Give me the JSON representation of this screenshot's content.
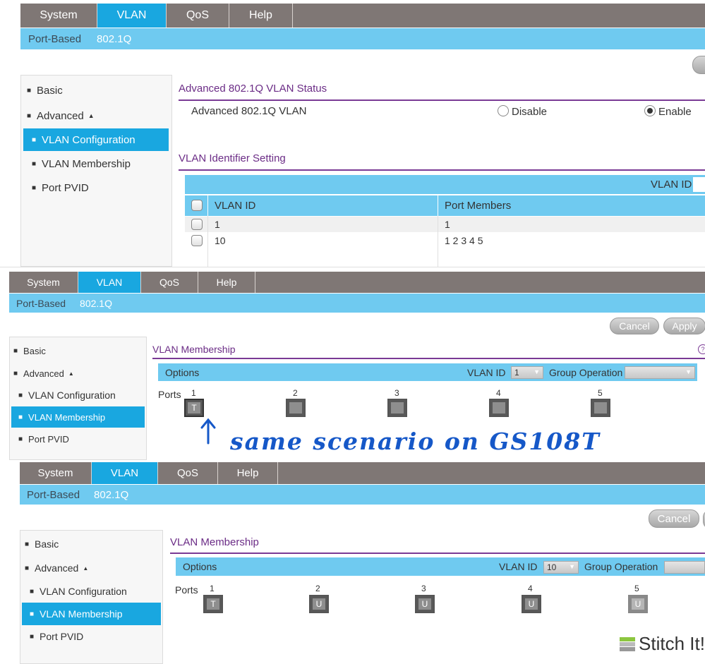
{
  "nav": [
    "System",
    "VLAN",
    "QoS",
    "Help"
  ],
  "subnav": [
    "Port-Based",
    "802.1Q"
  ],
  "sidebar": {
    "basic": "Basic",
    "advanced": "Advanced",
    "items": [
      "VLAN Configuration",
      "VLAN Membership",
      "Port PVID"
    ]
  },
  "panel1": {
    "status_title": "Advanced 802.1Q VLAN Status",
    "status_label": "Advanced 802.1Q VLAN",
    "disable": "Disable",
    "enable": "Enable",
    "selected": "Enable",
    "id_title": "VLAN Identifier Setting",
    "vlan_id_label": "VLAN ID",
    "columns": [
      "VLAN ID",
      "Port Members"
    ],
    "rows": [
      {
        "vlan_id": "1",
        "members": "1"
      },
      {
        "vlan_id": "10",
        "members": "1 2 3 4 5"
      }
    ]
  },
  "panel2": {
    "cancel": "Cancel",
    "apply": "Apply",
    "title": "VLAN Membership",
    "options": "Options",
    "vlan_id_label": "VLAN ID",
    "vlan_id_value": "1",
    "group_operation": "Group Operation",
    "ports_label": "Ports",
    "ports": [
      {
        "num": "1",
        "mark": "T"
      },
      {
        "num": "2",
        "mark": ""
      },
      {
        "num": "3",
        "mark": ""
      },
      {
        "num": "4",
        "mark": ""
      },
      {
        "num": "5",
        "mark": ""
      }
    ],
    "annotation": "same scenario on GS108T"
  },
  "panel3": {
    "cancel": "Cancel",
    "title": "VLAN Membership",
    "options": "Options",
    "vlan_id_label": "VLAN ID",
    "vlan_id_value": "10",
    "group_operation": "Group Operation",
    "ports_label": "Ports",
    "ports": [
      {
        "num": "1",
        "mark": "T"
      },
      {
        "num": "2",
        "mark": "U"
      },
      {
        "num": "3",
        "mark": "U"
      },
      {
        "num": "4",
        "mark": "U"
      },
      {
        "num": "5",
        "mark": "U"
      }
    ]
  },
  "watermark": "Stitch It!",
  "colors": {
    "accent": "#19a7e0",
    "light_blue": "#6fcaf0",
    "nav_gray": "#7f7775",
    "purple": "#6b2c86",
    "annotation": "#1658c8"
  }
}
